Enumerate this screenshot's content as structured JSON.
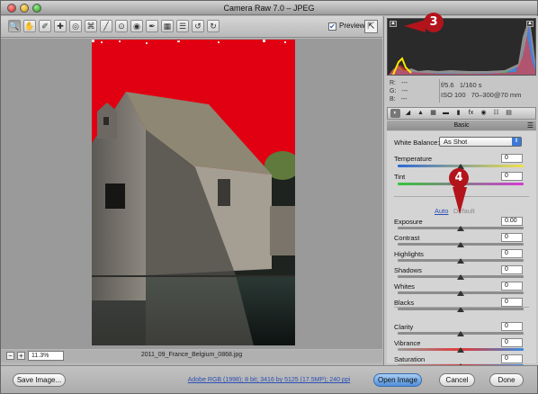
{
  "window": {
    "title": "Camera Raw 7.0  –  JPEG"
  },
  "toolbar": {
    "tools": [
      {
        "name": "zoom-tool-icon",
        "glyph": "🔍"
      },
      {
        "name": "hand-tool-icon",
        "glyph": "✋"
      },
      {
        "name": "white-balance-tool-icon",
        "glyph": "✐"
      },
      {
        "name": "color-sampler-tool-icon",
        "glyph": "✚"
      },
      {
        "name": "targeted-adjustment-tool-icon",
        "glyph": "◎"
      },
      {
        "name": "crop-tool-icon",
        "glyph": "⌘"
      },
      {
        "name": "straighten-tool-icon",
        "glyph": "╱"
      },
      {
        "name": "spot-removal-tool-icon",
        "glyph": "⊙"
      },
      {
        "name": "red-eye-tool-icon",
        "glyph": "◉"
      },
      {
        "name": "adjustment-brush-icon",
        "glyph": "✒"
      },
      {
        "name": "graduated-filter-icon",
        "glyph": "▦"
      },
      {
        "name": "preferences-icon",
        "glyph": "☰"
      },
      {
        "name": "rotate-left-icon",
        "glyph": "↺"
      },
      {
        "name": "rotate-right-icon",
        "glyph": "↻"
      }
    ],
    "preview_label": "Preview",
    "preview_checked": true
  },
  "canvas": {
    "zoom": "11.3%",
    "filename": "2011_09_France_Belgium_0868.jpg"
  },
  "histogram": {
    "readout": {
      "r_label": "R:",
      "g_label": "G:",
      "b_label": "B:",
      "r": "---",
      "g": "---",
      "b": "---"
    },
    "aperture": "f/5.6",
    "shutter": "1/160 s",
    "iso": "ISO 100",
    "lens": "70–300@70 mm"
  },
  "panel": {
    "section_title": "Basic",
    "white_balance_label": "White Balance:",
    "white_balance_value": "As Shot",
    "auto": "Auto",
    "default": "Default",
    "sliders": [
      {
        "label": "Temperature",
        "value": "0"
      },
      {
        "label": "Tint",
        "value": "0"
      },
      {
        "label": "Exposure",
        "value": "0.00"
      },
      {
        "label": "Contrast",
        "value": "0"
      },
      {
        "label": "Highlights",
        "value": "0"
      },
      {
        "label": "Shadows",
        "value": "0"
      },
      {
        "label": "Whites",
        "value": "0"
      },
      {
        "label": "Blacks",
        "value": "0"
      },
      {
        "label": "Clarity",
        "value": "0"
      },
      {
        "label": "Vibrance",
        "value": "0"
      },
      {
        "label": "Saturation",
        "value": "0"
      }
    ]
  },
  "footer": {
    "save": "Save Image...",
    "workflow": "Adobe RGB (1998); 8 bit; 3416 by 5125 (17.5MP); 240 ppi",
    "open": "Open Image",
    "cancel": "Cancel",
    "done": "Done"
  },
  "callouts": {
    "c3": "3",
    "c4": "4"
  },
  "colors": {
    "clipping_warning": "#e00012",
    "accent": "#3c78d8",
    "callout": "#b3141b"
  }
}
